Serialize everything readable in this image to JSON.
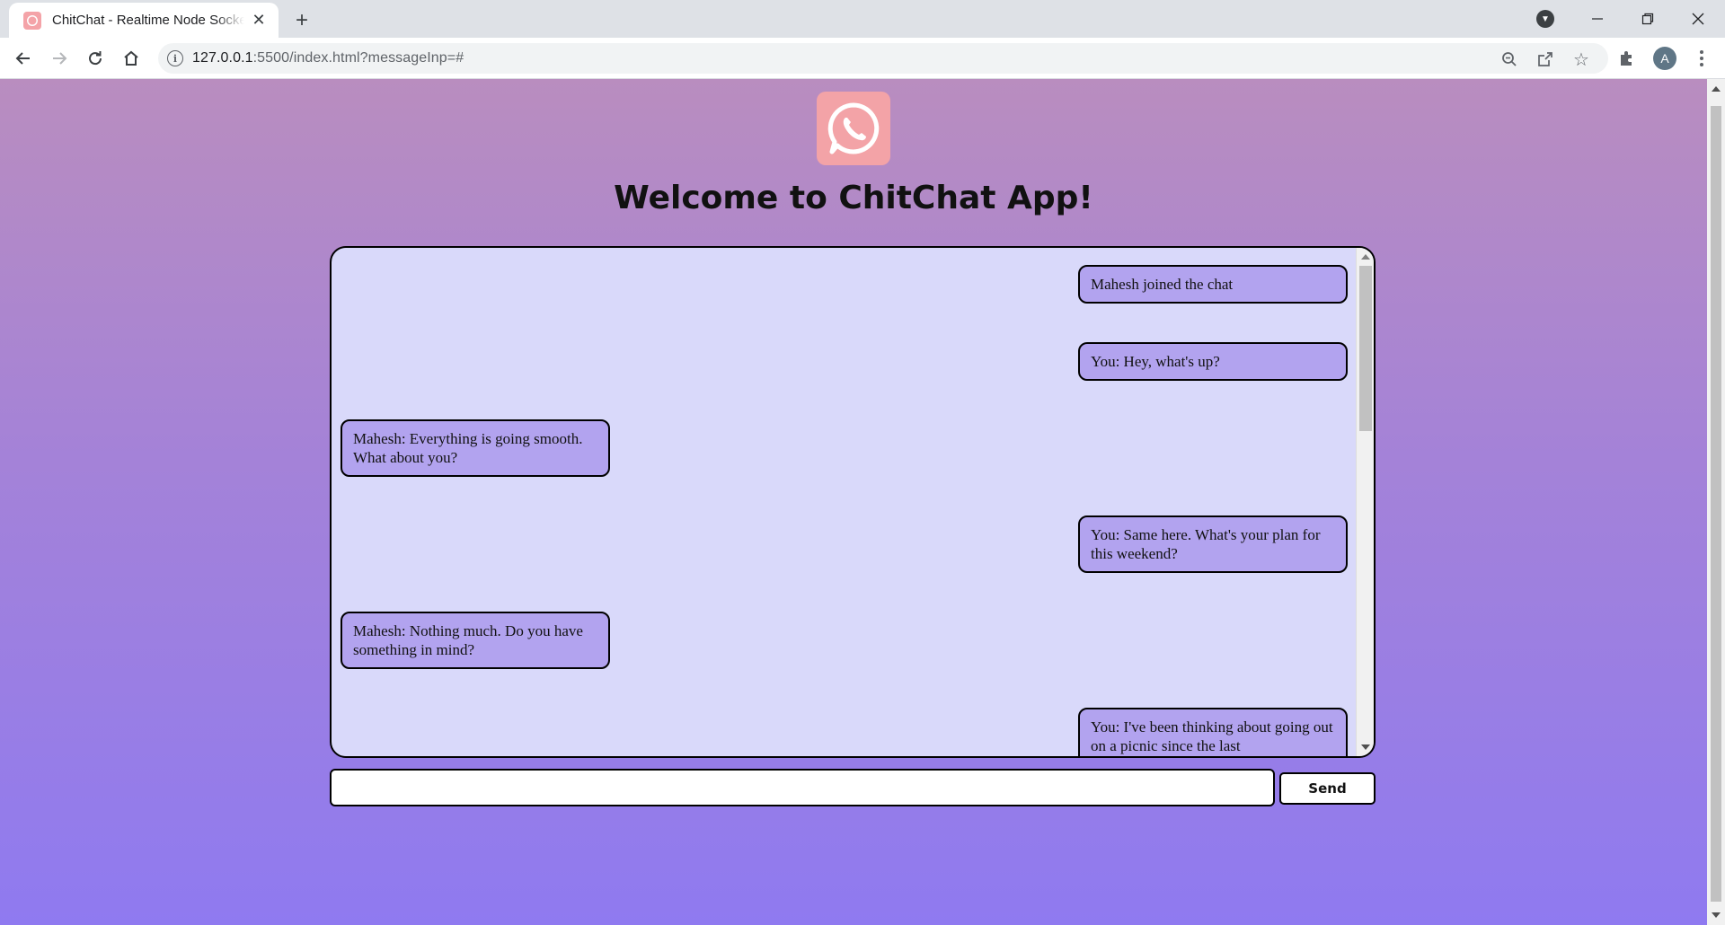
{
  "browser": {
    "tab_title": "ChitChat - Realtime Node Socket",
    "tab_close": "✕",
    "new_tab": "+",
    "url_host": "127.0.0.1",
    "url_rest": ":5500/index.html?messageInp=#",
    "avatar_letter": "A",
    "icons": [
      "chat-favicon-icon",
      "back-icon",
      "forward-icon",
      "reload-icon",
      "home-icon",
      "info-icon",
      "zoom-out-icon",
      "share-icon",
      "star-icon",
      "extensions-icon",
      "menu-icon",
      "tab-search-icon",
      "minimize-icon",
      "restore-icon",
      "close-icon"
    ]
  },
  "page": {
    "title": "Welcome to ChitChat App!",
    "logo_icon": "whatsapp-phone-icon",
    "logo_color": "#f3a3a7",
    "bubble_color": "#b2a3ef",
    "chat_bg_color": "#d9d9fa"
  },
  "messages": [
    {
      "side": "right",
      "text": "Mahesh joined the chat"
    },
    {
      "side": "right",
      "text": "You: Hey, what's up?"
    },
    {
      "side": "left",
      "text": "Mahesh: Everything is going smooth. What about you?"
    },
    {
      "side": "right",
      "text": "You: Same here. What's your plan for this weekend?"
    },
    {
      "side": "left",
      "text": "Mahesh: Nothing much. Do you have something in mind?"
    },
    {
      "side": "right",
      "text": "You: I've been thinking about going out on a picnic since the last"
    }
  ],
  "composer": {
    "input_value": "",
    "send_label": "Send"
  }
}
